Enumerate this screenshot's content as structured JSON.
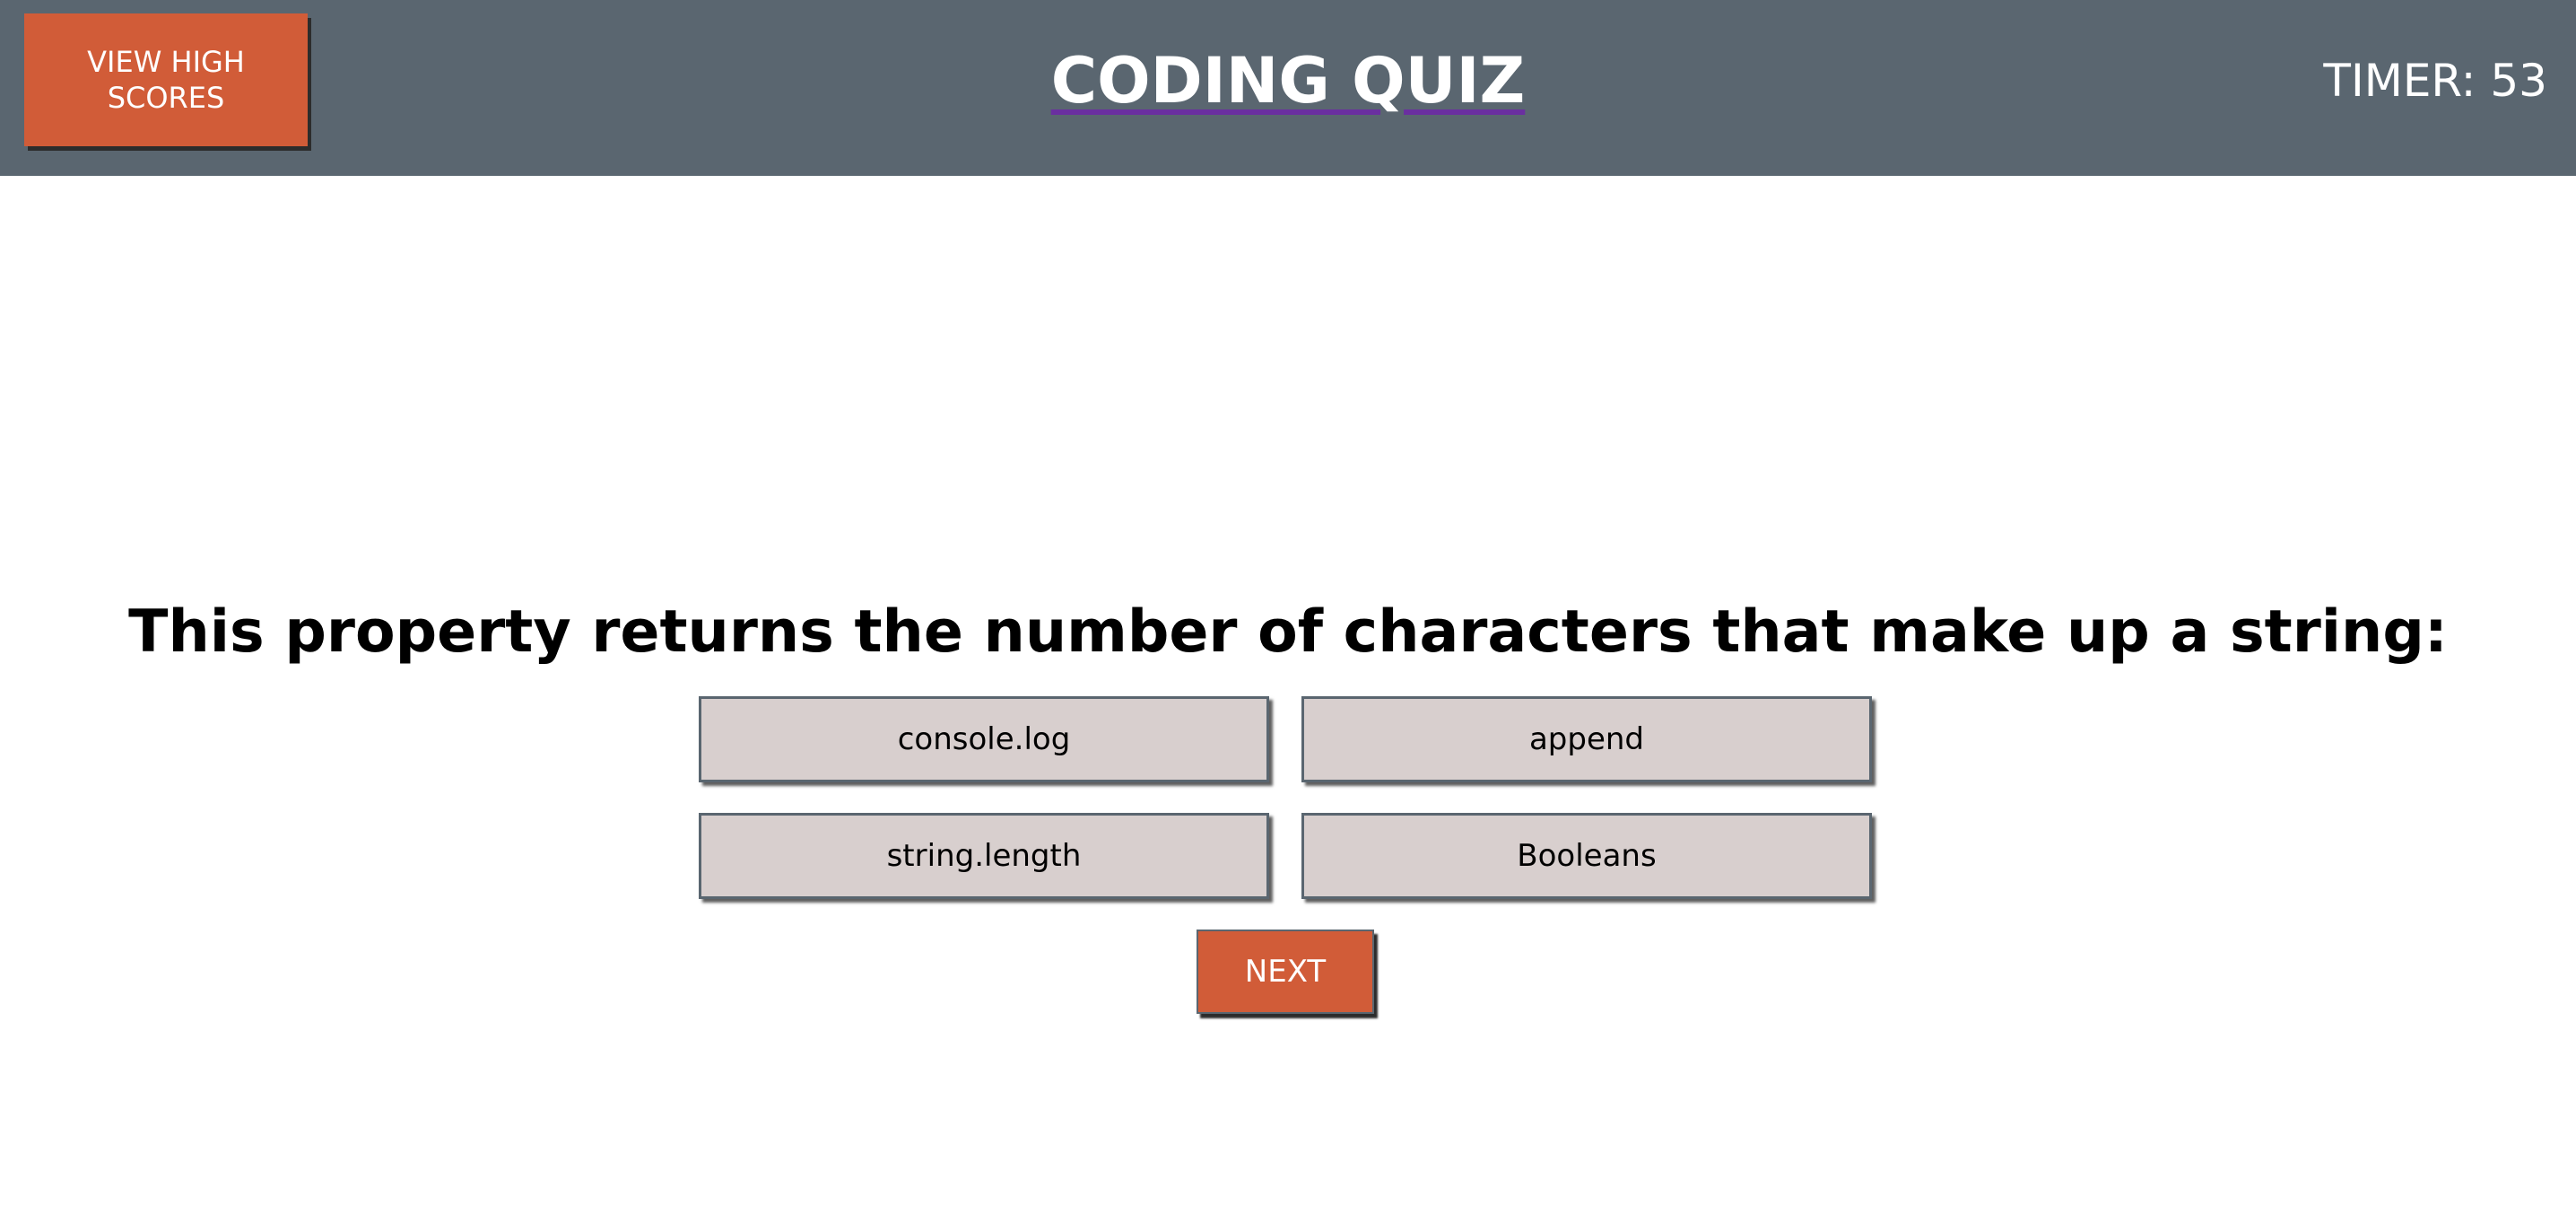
{
  "header": {
    "high_scores_label": "VIEW HIGH SCORES",
    "title": "CODING QUIZ",
    "timer": "TIMER: 53"
  },
  "quiz": {
    "question": "This property returns the number of characters that make up a string:",
    "answers": [
      "console.log",
      "append",
      "string.length",
      "Booleans"
    ],
    "next_label": "NEXT"
  },
  "colors": {
    "header_bg": "#5a6670",
    "accent": "#d15c38",
    "answer_bg": "#d8cfce",
    "title_underline": "#6a2fa0"
  }
}
